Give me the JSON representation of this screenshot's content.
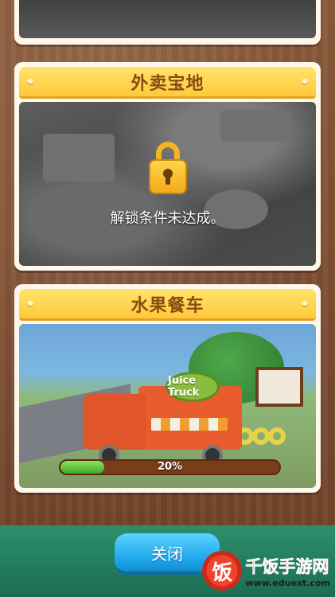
{
  "cards": [
    {
      "title": "",
      "state": "locked"
    },
    {
      "title": "外卖宝地",
      "state": "locked",
      "lock_message": "解锁条件未达成。"
    },
    {
      "title": "水果餐车",
      "state": "unlocked",
      "progress_percent": 20,
      "progress_label": "20%",
      "sign_text": "Juice Truck"
    }
  ],
  "close_button": {
    "label": "关闭"
  },
  "watermark": {
    "logo_char": "饭",
    "name": "千饭手游网",
    "url": "www.eduext.com"
  },
  "colors": {
    "banner": "#ffc93b",
    "button": "#1ea5ea",
    "progress_fill": "#3eaa2a",
    "lock": "#f2a91a"
  }
}
